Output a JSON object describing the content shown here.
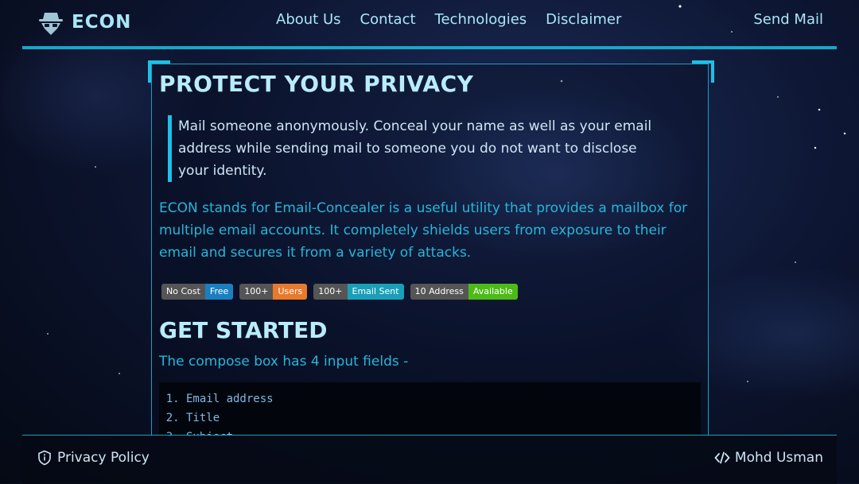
{
  "header": {
    "logo_text": "ECON",
    "nav": [
      "About Us",
      "Contact",
      "Technologies",
      "Disclaimer"
    ],
    "send_mail": "Send Mail"
  },
  "main": {
    "title": "PROTECT YOUR PRIVACY",
    "quote": "Mail someone anonymously. Conceal your name as well as your email address while sending mail to someone you do not want to disclose your identity.",
    "description": "ECON stands for Email-Concealer is a useful utility that provides a mailbox for multiple email accounts. It completely shields users from exposure to their email and secures it from a variety of attacks.",
    "badges": [
      {
        "left": "No Cost",
        "right": "Free",
        "color": "#1a7fc0"
      },
      {
        "left": "100+",
        "right": "Users",
        "color": "#e87a2d"
      },
      {
        "left": "100+",
        "right": "Email Sent",
        "color": "#1a9fb8"
      },
      {
        "left": "10 Address",
        "right": "Available",
        "color": "#4cbb17"
      }
    ],
    "get_started_title": "GET STARTED",
    "get_started_text": "The compose box has 4 input fields -",
    "fields": [
      "Email address",
      "Title",
      "Subject"
    ]
  },
  "footer": {
    "privacy": "Privacy Policy",
    "author": "Mohd Usman"
  },
  "colors": {
    "accent": "#1ec0e6",
    "text_cyan": "#27b6d8",
    "heading": "#b8ecfb"
  }
}
